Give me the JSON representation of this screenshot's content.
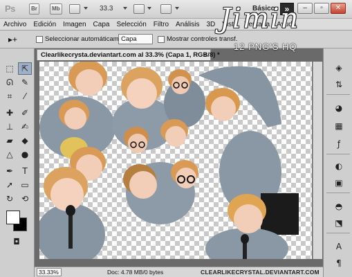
{
  "app": {
    "logo": "Ps",
    "chips": [
      "Br",
      "Mb"
    ],
    "zoom": "33.3",
    "workspace": "Básico",
    "workspace_switch_glyph": "»",
    "window_buttons": [
      "–",
      "▫",
      "✕"
    ]
  },
  "menu": {
    "items": [
      "Archivo",
      "Edición",
      "Imagen",
      "Capa",
      "Selección",
      "Filtro",
      "Análisis",
      "3D",
      "Vista",
      "Ventana",
      "Ayuda"
    ]
  },
  "options": {
    "move_glyph": "▸+",
    "auto_select_label": "Seleccionar automáticamente:",
    "auto_select_value": "Capa",
    "transform_label": "Mostrar controles transf."
  },
  "document": {
    "tab_title": "Clearlikecrysta.deviantart.com al 33.3% (Capa 1, RGB/8) *",
    "close_glyph": "×"
  },
  "status": {
    "zoom": "33.33%",
    "doc_info": "Doc: 4.78 MB/0 bytes",
    "credit": "CLEARLIKECRYSTAL.DEVIANTART.COM"
  },
  "overlay": {
    "title": "Jimin",
    "subtitle": "12 PNG'S HQ"
  },
  "colors": {
    "foreground": "#ffffff",
    "background": "#000000",
    "sweater": "#8a98a6",
    "hair": "#d99a55",
    "skin": "#f2cdb8"
  },
  "tools": [
    "marquee-icon",
    "move-icon",
    "lasso-icon",
    "quick-select-icon",
    "crop-icon",
    "eyedropper-icon",
    "healing-icon",
    "brush-icon",
    "stamp-icon",
    "history-brush-icon",
    "eraser-icon",
    "bucket-icon",
    "blur-icon",
    "dodge-icon",
    "pen-icon",
    "type-icon",
    "path-select-icon",
    "shape-icon",
    "3d-rotate-icon",
    "3d-orbit-icon",
    "hand-icon",
    "zoom-icon"
  ],
  "dock": [
    "layers-icon",
    "channels-icon",
    "swatches-icon",
    "adjustments-icon",
    "fx-icon",
    "mask-icon",
    "info-icon",
    "3d-icon",
    "styles-icon",
    "character-icon",
    "paragraph-icon"
  ]
}
